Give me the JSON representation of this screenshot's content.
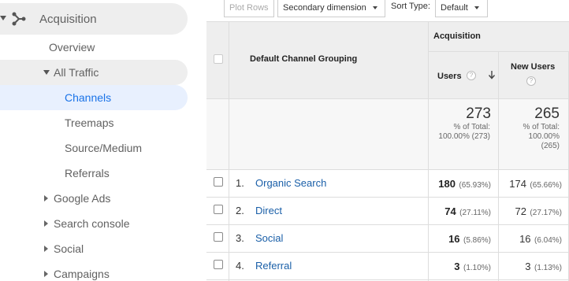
{
  "sidebar": {
    "acquisition": "Acquisition",
    "overview": "Overview",
    "all_traffic": "All Traffic",
    "channels": "Channels",
    "treemaps": "Treemaps",
    "source_medium": "Source/Medium",
    "referrals": "Referrals",
    "google_ads": "Google Ads",
    "search_console": "Search console",
    "social": "Social",
    "campaigns": "Campaigns"
  },
  "toolbar": {
    "plot_rows": "Plot Rows",
    "secondary_dimension": "Secondary dimension",
    "sort_type_label": "Sort Type:",
    "sort_type_value": "Default"
  },
  "table": {
    "dimension_header": "Default Channel Grouping",
    "group_header": "Acquisition",
    "col_users": "Users",
    "col_new_users": "New Users",
    "totals": {
      "users": "273",
      "users_sub1": "% of Total:",
      "users_sub2": "100.00% (273)",
      "new_users": "265",
      "new_users_sub1": "% of Total:",
      "new_users_sub2": "100.00%",
      "new_users_sub3": "(265)"
    },
    "rows": [
      {
        "num": "1.",
        "channel": "Organic Search",
        "users": "180",
        "users_pct": "(65.93%)",
        "new_users": "174",
        "new_users_pct": "(65.66%)"
      },
      {
        "num": "2.",
        "channel": "Direct",
        "users": "74",
        "users_pct": "(27.11%)",
        "new_users": "72",
        "new_users_pct": "(27.17%)"
      },
      {
        "num": "3.",
        "channel": "Social",
        "users": "16",
        "users_pct": "(5.86%)",
        "new_users": "16",
        "new_users_pct": "(6.04%)"
      },
      {
        "num": "4.",
        "channel": "Referral",
        "users": "3",
        "users_pct": "(1.10%)",
        "new_users": "3",
        "new_users_pct": "(1.13%)"
      }
    ]
  }
}
